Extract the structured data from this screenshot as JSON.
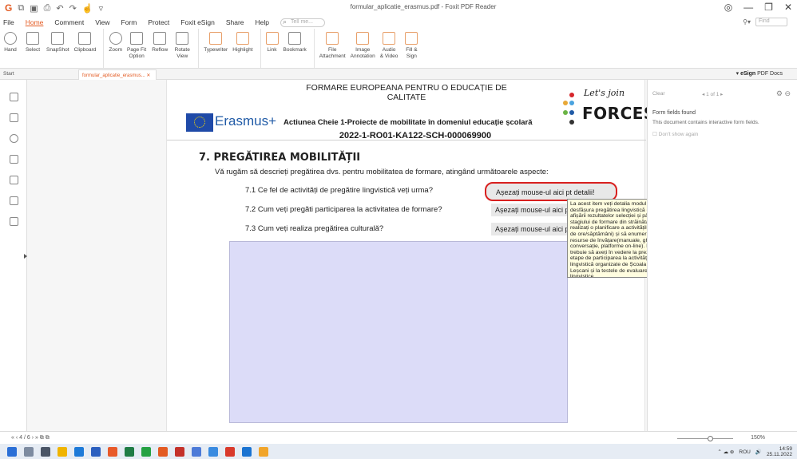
{
  "window": {
    "title": "formular_aplicatie_erasmus.pdf - Foxit PDF Reader"
  },
  "menu": {
    "items": [
      "File",
      "Home",
      "Comment",
      "View",
      "Form",
      "Protect",
      "Foxit eSign",
      "Share",
      "Help"
    ],
    "active": "Home",
    "tell_me_placeholder": "Tell me...",
    "find_placeholder": "Find"
  },
  "ribbon": {
    "buttons": [
      "Hand",
      "Select",
      "SnapShot",
      "Clipboard",
      "Zoom",
      "Page Fit\nOption",
      "Reflow",
      "Rotate\nView",
      "Typewriter",
      "Highlight",
      "Link",
      "Bookmark",
      "File\nAttachment",
      "Image\nAnnotation",
      "Audio\n& Video",
      "Fill &\nSign"
    ]
  },
  "tabs": {
    "start": "Start",
    "document": "formular_aplicatie_erasmus...",
    "esign": "eSign",
    "esign_suffix": "PDF Docs"
  },
  "document": {
    "header_line": "FORMARE EUROPEANA PENTRU O EDUCAȚIE DE CALITATE",
    "erasmus_label": "Erasmus+",
    "action_line": "Actiunea Cheie 1-Proiecte de mobilitate în domeniul educație școlară",
    "project_code": "2022-1-RO01-KA122-SCH-000069900",
    "logo_join": "Let's join",
    "logo_forces": "FORCES",
    "section_title": "7.  PREGĂTIREA MOBILITĂȚII",
    "intro": "Vă rugăm să descrieți pregătirea dvs. pentru mobilitatea de formare, atingând următoarele aspecte:",
    "questions": [
      {
        "text": "7.1 Ce fel de activități de pregătire lingvistică veți urma?",
        "field": "Așezați mouse-ul aici pt detalii!"
      },
      {
        "text": "7.2 Cum veți pregăti participarea la activitatea de formare?",
        "field": "Așezați mouse-ul aici pt detalii!"
      },
      {
        "text": "7.3 Cum veți realiza pregătirea culturală?",
        "field": "Așezați mouse-ul aici pt detalii!"
      }
    ]
  },
  "tooltip": {
    "text": "La acest item veți detalia modul în care veți desfășura pregătirea lingvistică din momentul afișării rezultatelor selecției și până la începutul stagiului de formare din străinătate. Trebuie să realizați o planificare a activităților de pregătire (nr de ore/săptămâni) și să enumerați o serie de resurse de învățare(manuale, ghiduri de conversație, platforme on-line). De asemenea, trebuie să aveți în vedere la prezentarea acestei etape de participarea la activitățile de pregătire lingvistică organizate de Școala Gimnazială Leșcani și la testele de evaluare a pregătirii lingvistice."
  },
  "right_panel": {
    "clear": "Clear",
    "nav": "1 of 1",
    "title": "Form fields found",
    "description": "This document contains interactive form fields.",
    "dont_show": "Don't show again"
  },
  "status": {
    "page": "4 / 6",
    "zoom": "150%"
  },
  "taskbar": {
    "lang": "ROU",
    "time": "14:59",
    "date": "25.11.2022"
  },
  "colors": {
    "accent": "#e35b23",
    "erasmus_blue": "#1f5aa6",
    "highlight_red": "#d8201f",
    "form_box": "#dcdcf8",
    "tooltip_bg": "#fffde0"
  }
}
